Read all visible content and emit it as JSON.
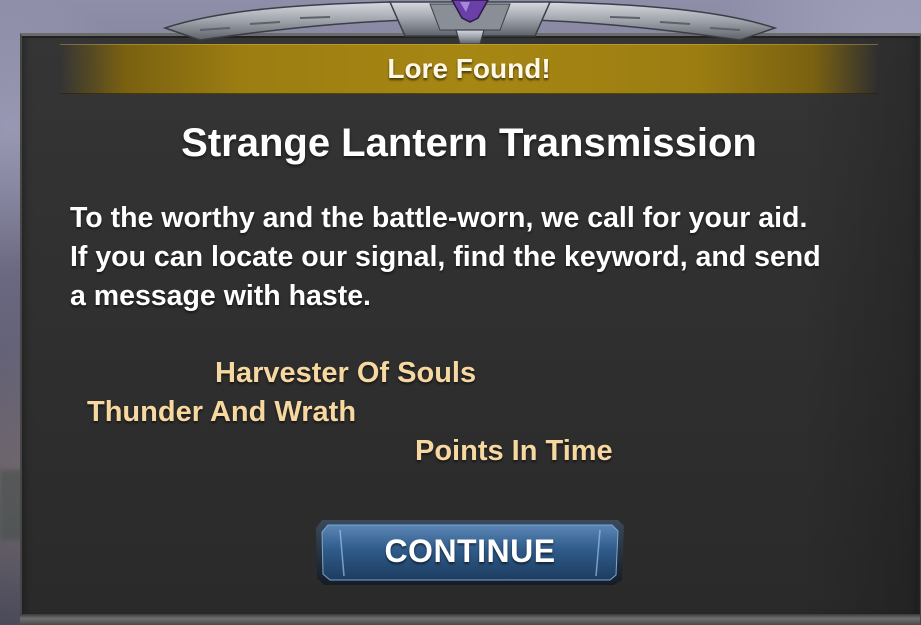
{
  "dialog": {
    "banner_title": "Lore Found!",
    "title": "Strange Lantern Transmission",
    "body_lines": [
      "To the worthy and the battle-worn, we call for your aid.",
      "If you can locate our signal, find the keyword, and send",
      "a message with haste."
    ],
    "keywords": [
      "Harvester Of Souls",
      "Thunder And Wrath",
      "Points In Time"
    ],
    "continue_label": "CONTINUE"
  },
  "colors": {
    "panel": "#2e2e2e",
    "banner_gold": "#a78713",
    "keyword_text": "#f7d8a0",
    "button_blue": "#2f5b8a",
    "crest_gem": "#6a3fa8"
  },
  "icons": {
    "crest": "winged-crest-icon",
    "gem": "purple-gem-icon"
  }
}
